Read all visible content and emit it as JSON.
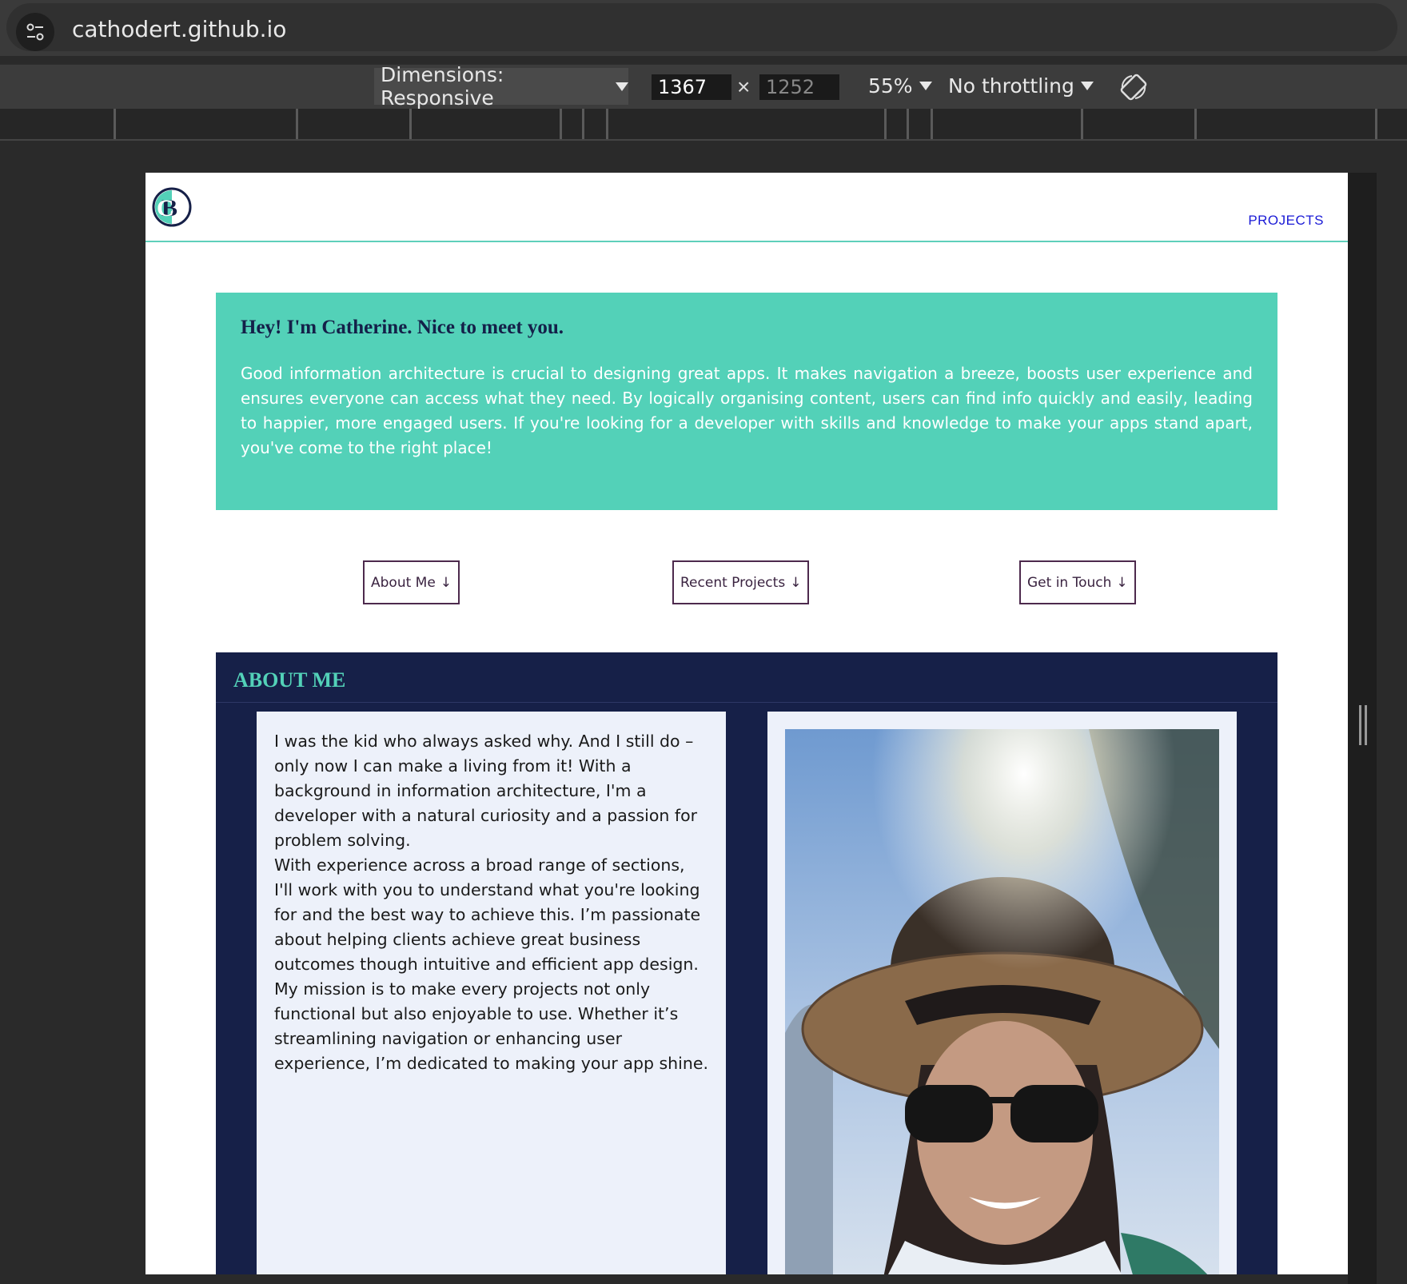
{
  "browser": {
    "url": "cathodert.github.io"
  },
  "devtools": {
    "dimensions_label": "Dimensions: Responsive",
    "width": "1367",
    "height": "1252",
    "zoom": "55%",
    "throttling": "No throttling"
  },
  "site": {
    "nav": {
      "projects": "PROJECTS"
    },
    "hero": {
      "heading": "Hey! I'm Catherine. Nice to meet you.",
      "body": "Good information architecture is crucial to designing great apps. It makes navigation a breeze, boosts user experience and ensures everyone can access what they need. By logically organising content, users can find info quickly and easily, leading to happier, more engaged users. If you're looking for a developer with skills and knowledge to make your apps stand apart, you've come to the right place!"
    },
    "jump_links": [
      {
        "label": "About Me"
      },
      {
        "label": "Recent Projects"
      },
      {
        "label": "Get in Touch"
      }
    ],
    "about": {
      "title": "ABOUT ME",
      "paragraphs": [
        "I was the kid who always asked why. And I still do – only now I can make a living from it! With a background in information architecture, I'm a developer with a natural curiosity and a passion for problem solving.",
        "With experience across a broad range of sections, I'll work with you to understand what you're looking for and the best way to achieve this. I’m passionate about helping clients achieve great business outcomes though intuitive and efficient app design.",
        "My mission is to make every projects not only functional but also enjoyable to use. Whether it’s streamlining navigation or enhancing user experience, I’m dedicated to making your app shine."
      ]
    }
  },
  "colors": {
    "accent_teal": "#53d1b8",
    "navy": "#162048",
    "card_bg": "#edf1fa",
    "link_blue": "#1a1ad6"
  }
}
